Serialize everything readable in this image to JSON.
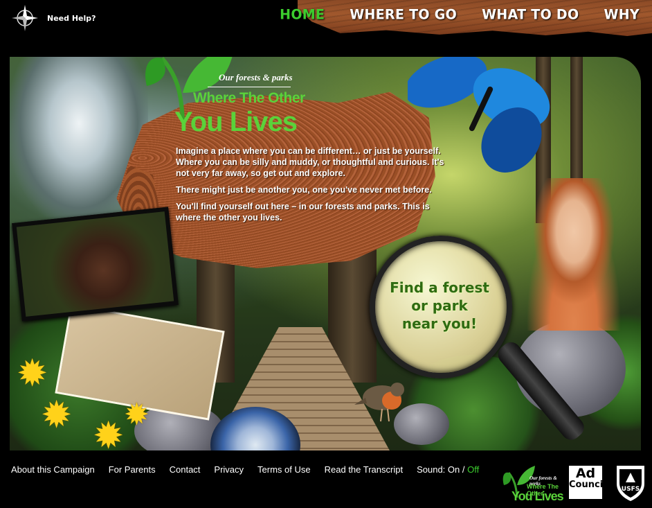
{
  "header": {
    "help_label": "Need Help?",
    "nav": [
      {
        "label": "HOME",
        "active": true
      },
      {
        "label": "WHERE TO GO",
        "active": false
      },
      {
        "label": "WHAT TO DO",
        "active": false
      },
      {
        "label": "WHY",
        "active": false
      }
    ]
  },
  "hero": {
    "logo_sub": "Our forests & parks",
    "logo_title_top": "Where The Other",
    "logo_title_bottom": "You Lives",
    "paragraphs": [
      "Imagine a place where you can be different… or just be yourself. Where you can be silly and muddy, or thoughtful and curious. It's not very far away, so get out and explore.",
      "There might just be another you, one you've never met before.",
      "You'll find yourself out here – in our forests and parks. This is where the other you lives."
    ],
    "finder_lines": [
      "Find a forest",
      "or park",
      "near you!"
    ]
  },
  "footer": {
    "links": [
      "About this Campaign",
      "For Parents",
      "Contact",
      "Privacy",
      "Terms of Use",
      "Read the Transcript"
    ],
    "sound_label": "Sound:",
    "sound_on": "On",
    "sound_sep": "/",
    "sound_off": "Off",
    "mini_logo_sub": "Our forests & parks",
    "mini_logo_top": "Where The Other",
    "mini_logo_bottom": "You Lives",
    "ad_top": "Ad",
    "ad_bottom": "Council",
    "usfs_text": "USFS"
  },
  "colors": {
    "accent_green": "#3ccd2e",
    "logo_green": "#5ad23a",
    "wood": "#a0582d",
    "finder_text": "#2f6b12"
  }
}
